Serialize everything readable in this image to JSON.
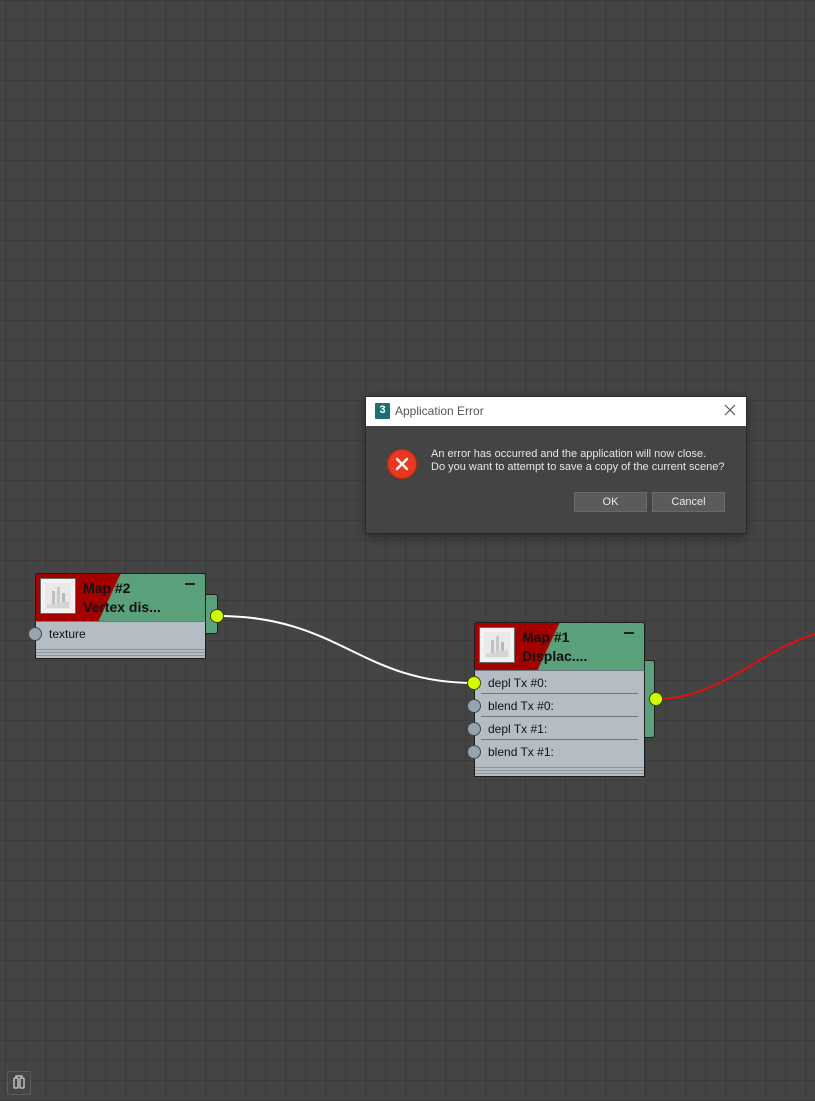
{
  "dialog": {
    "title": "Application Error",
    "app_icon_glyph": "3",
    "message_line1": "An error has occurred and the application will now close.",
    "message_line2": "Do you want to attempt to save a copy of the current scene?",
    "ok_label": "OK",
    "cancel_label": "Cancel",
    "icons": {
      "close": "close-icon",
      "error": "error-icon",
      "app": "app-icon"
    }
  },
  "nodes": {
    "map2": {
      "title_line1": "Map #2",
      "title_line2": "Vertex dis...",
      "slots": [
        "texture"
      ]
    },
    "map1": {
      "title_line1": "Map #1",
      "title_line2": "Displac....",
      "slots": [
        "depl Tx #0:",
        "blend Tx #0:",
        "depl Tx #1:",
        "blend Tx #1:"
      ]
    }
  },
  "colors": {
    "canvas_bg": "#444444",
    "grid_line": "#3c3c3c",
    "node_header_green": "#5aa07a",
    "node_header_red": "#a40000",
    "node_body": "#b5bdc4",
    "socket_active": "#d4ff00",
    "socket_inactive": "#97a4b0",
    "wire_white": "#ffffff",
    "wire_red": "#e01010",
    "error_red": "#e8381f"
  }
}
